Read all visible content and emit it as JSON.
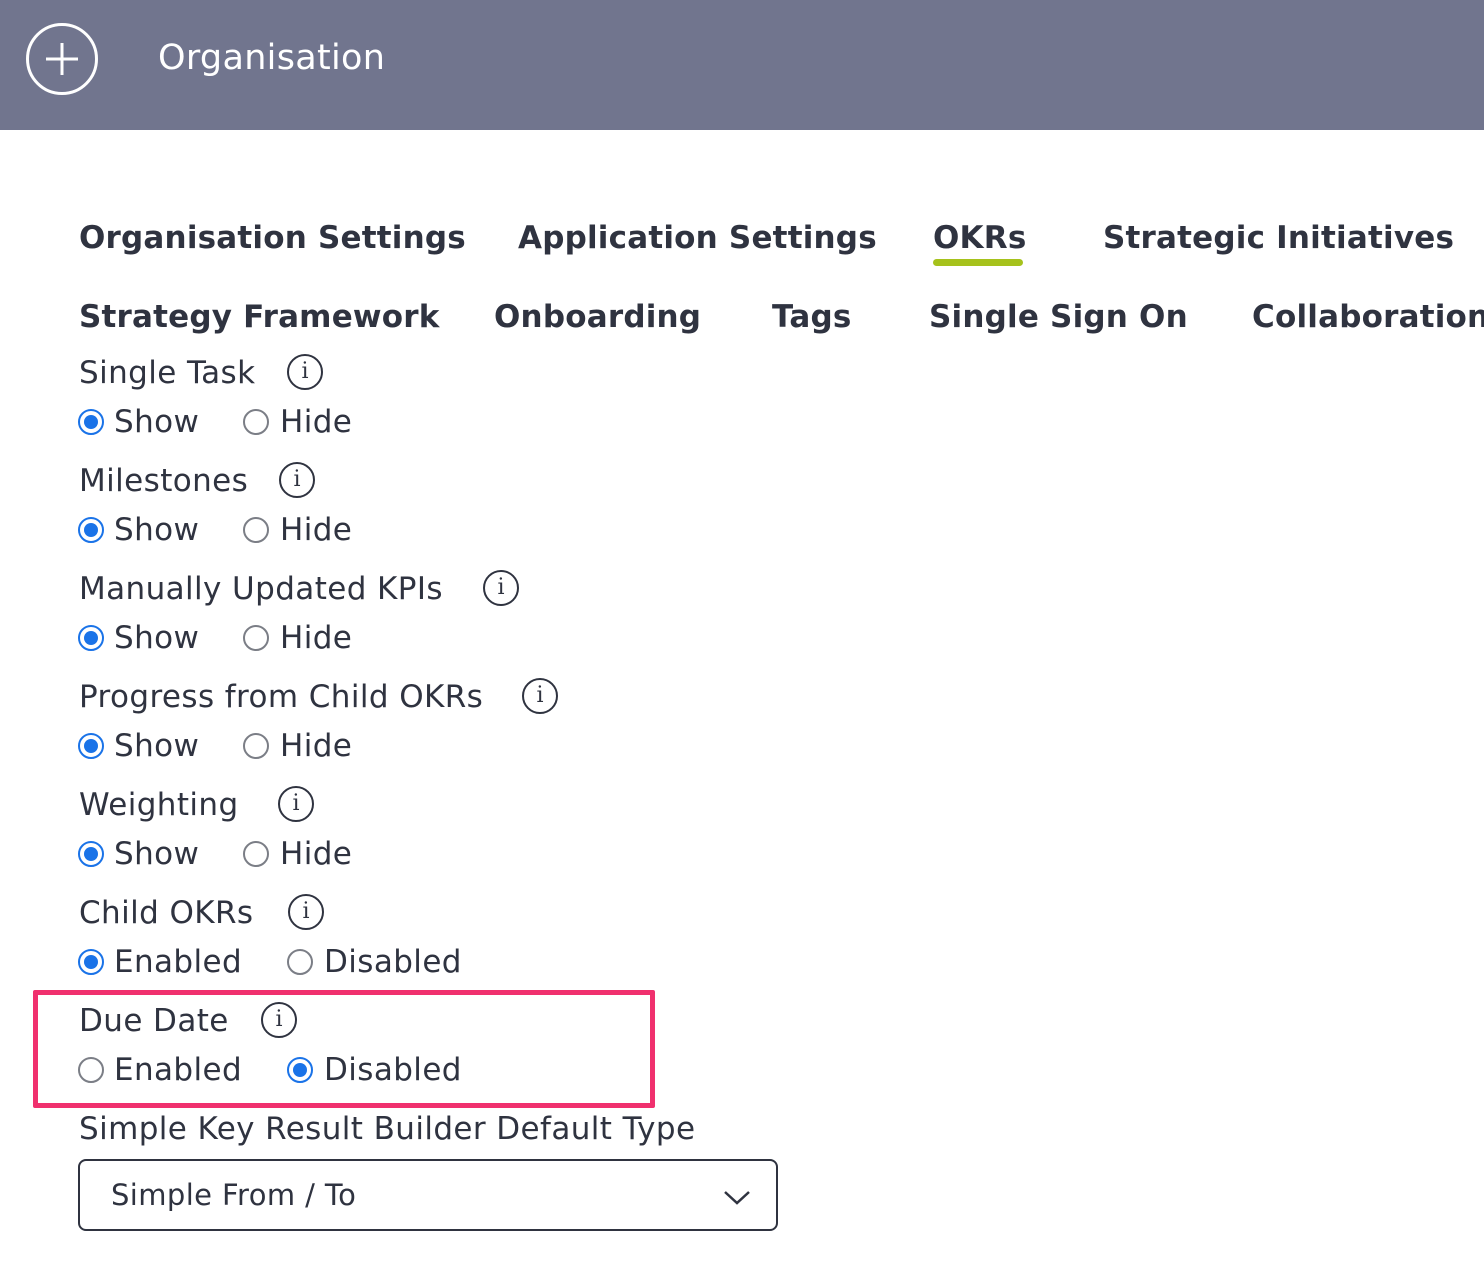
{
  "header": {
    "title": "Organisation",
    "add_icon": "plus-circle-icon"
  },
  "tabs": {
    "organisation_settings": "Organisation Settings",
    "application_settings": "Application Settings",
    "okrs": "OKRs",
    "strategic_initiatives": "Strategic Initiatives",
    "strategy_framework": "Strategy Framework",
    "onboarding": "Onboarding",
    "tags": "Tags",
    "single_sign_on": "Single Sign On",
    "collaboration": "Collaboration",
    "active": "OKRs",
    "active_color": "#a6c21c"
  },
  "settings": {
    "single_task": {
      "label": "Single Task",
      "option_a": "Show",
      "option_b": "Hide",
      "selected": "Show"
    },
    "milestones": {
      "label": "Milestones",
      "option_a": "Show",
      "option_b": "Hide",
      "selected": "Show"
    },
    "manual_kpis": {
      "label": "Manually Updated KPIs",
      "option_a": "Show",
      "option_b": "Hide",
      "selected": "Show"
    },
    "progress_child": {
      "label": "Progress from Child OKRs",
      "option_a": "Show",
      "option_b": "Hide",
      "selected": "Show"
    },
    "weighting": {
      "label": "Weighting",
      "option_a": "Show",
      "option_b": "Hide",
      "selected": "Show"
    },
    "child_okrs": {
      "label": "Child OKRs",
      "option_a": "Enabled",
      "option_b": "Disabled",
      "selected": "Enabled"
    },
    "due_date": {
      "label": "Due Date",
      "option_a": "Enabled",
      "option_b": "Disabled",
      "selected": "Disabled"
    }
  },
  "kr_builder": {
    "label": "Simple Key Result Builder Default Type",
    "selected_value": "Simple From / To"
  },
  "colors": {
    "header_bg": "#71758e",
    "radio_selected": "#1a73e8",
    "highlight": "#f0306e",
    "text": "#2f3340"
  }
}
